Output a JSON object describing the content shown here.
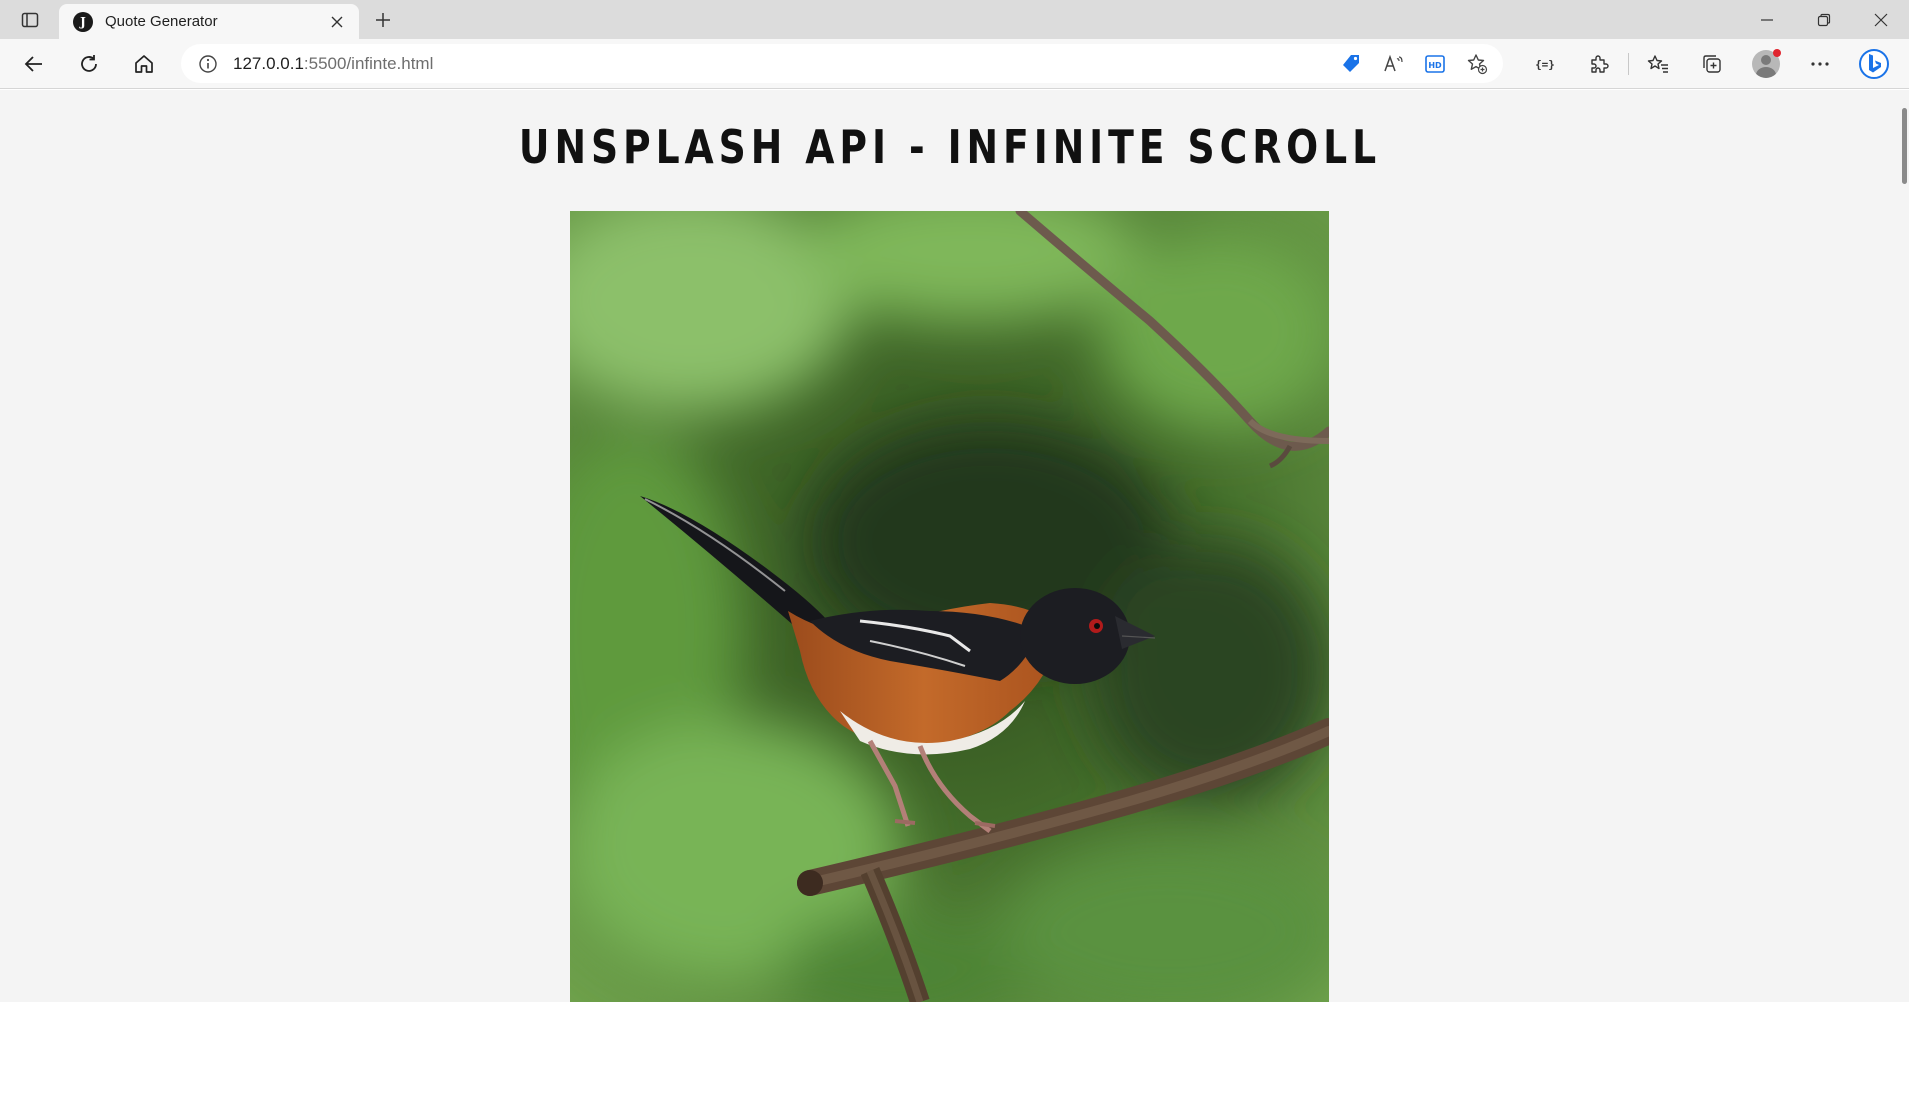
{
  "browser": {
    "tab": {
      "title": "Quote Generator",
      "favicon_letter": "J"
    },
    "address_bar": {
      "url_host": "127.0.0.1",
      "url_rest": ":5500/infinte.html"
    },
    "icons": {
      "tab_actions": "tab-actions-icon",
      "close_tab": "close-icon",
      "new_tab": "plus-icon",
      "back": "back-arrow-icon",
      "refresh": "refresh-icon",
      "home": "home-icon",
      "site_info": "info-icon",
      "shopping": "tag-icon",
      "read_aloud": "read-aloud-icon",
      "hd": "hd-icon",
      "add_favorite": "add-favorite-icon",
      "braces": "braces-icon",
      "extensions": "puzzle-icon",
      "favorites": "favorites-icon",
      "collections": "collections-icon",
      "profile": "profile-icon",
      "more": "more-icon",
      "copilot": "bing-icon"
    }
  },
  "page": {
    "title": "UNSPLASH API - INFINITE SCROLL",
    "image_alt": "Eastern towhee bird perched on a branch"
  },
  "colors": {
    "page_bg": "#f4f4f4",
    "accent": "#1a73e8"
  }
}
